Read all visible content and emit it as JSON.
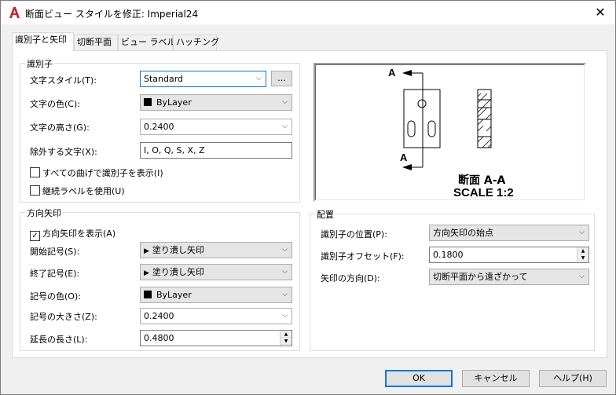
{
  "window": {
    "title": "断面ビュー スタイルを修正: Imperial24",
    "close_glyph": "✕"
  },
  "tabs": [
    {
      "label": "識別子と矢印"
    },
    {
      "label": "切断平面"
    },
    {
      "label": "ビュー ラベル"
    },
    {
      "label": "ハッチング"
    }
  ],
  "identifier": {
    "group_title": "識別子",
    "text_style_label": "文字スタイル(T):",
    "text_style_value": "Standard",
    "browse_label": "...",
    "text_color_label": "文字の色(C):",
    "text_color_value": "ByLayer",
    "text_height_label": "文字の高さ(G):",
    "text_height_value": "0.2400",
    "exclude_label": "除外する文字(X):",
    "exclude_value": "I, O, Q, S, X, Z",
    "show_all_bends_label": "すべての曲げで識別子を表示(I)",
    "show_all_bends_checked": false,
    "continuous_label": "継続ラベルを使用(U)",
    "continuous_checked": false
  },
  "direction_arrows": {
    "group_title": "方向矢印",
    "show_arrows_label": "方向矢印を表示(A)",
    "show_arrows_checked": true,
    "start_symbol_label": "開始記号(S):",
    "start_symbol_value": "塗り潰し矢印",
    "end_symbol_label": "終了記号(E):",
    "end_symbol_value": "塗り潰し矢印",
    "symbol_color_label": "記号の色(O):",
    "symbol_color_value": "ByLayer",
    "symbol_size_label": "記号の大きさ(Z):",
    "symbol_size_value": "0.2400",
    "extension_label": "延長の長さ(L):",
    "extension_value": "0.4800"
  },
  "preview": {
    "label_a_top": "A",
    "label_a_bottom": "A",
    "section_label": "断面 A-A",
    "scale_label": "SCALE 1:2"
  },
  "placement": {
    "group_title": "配置",
    "identifier_position_label": "識別子の位置(P):",
    "identifier_position_value": "方向矢印の始点",
    "identifier_offset_label": "識別子オフセット(F):",
    "identifier_offset_value": "0.1800",
    "arrow_direction_label": "矢印の方向(D):",
    "arrow_direction_value": "切断平面から遠ざかって"
  },
  "buttons": {
    "ok": "OK",
    "cancel": "キャンセル",
    "help": "ヘルプ(H)"
  },
  "colors": {
    "accent": "#0078d7",
    "app_icon_red": "#c4262e"
  }
}
